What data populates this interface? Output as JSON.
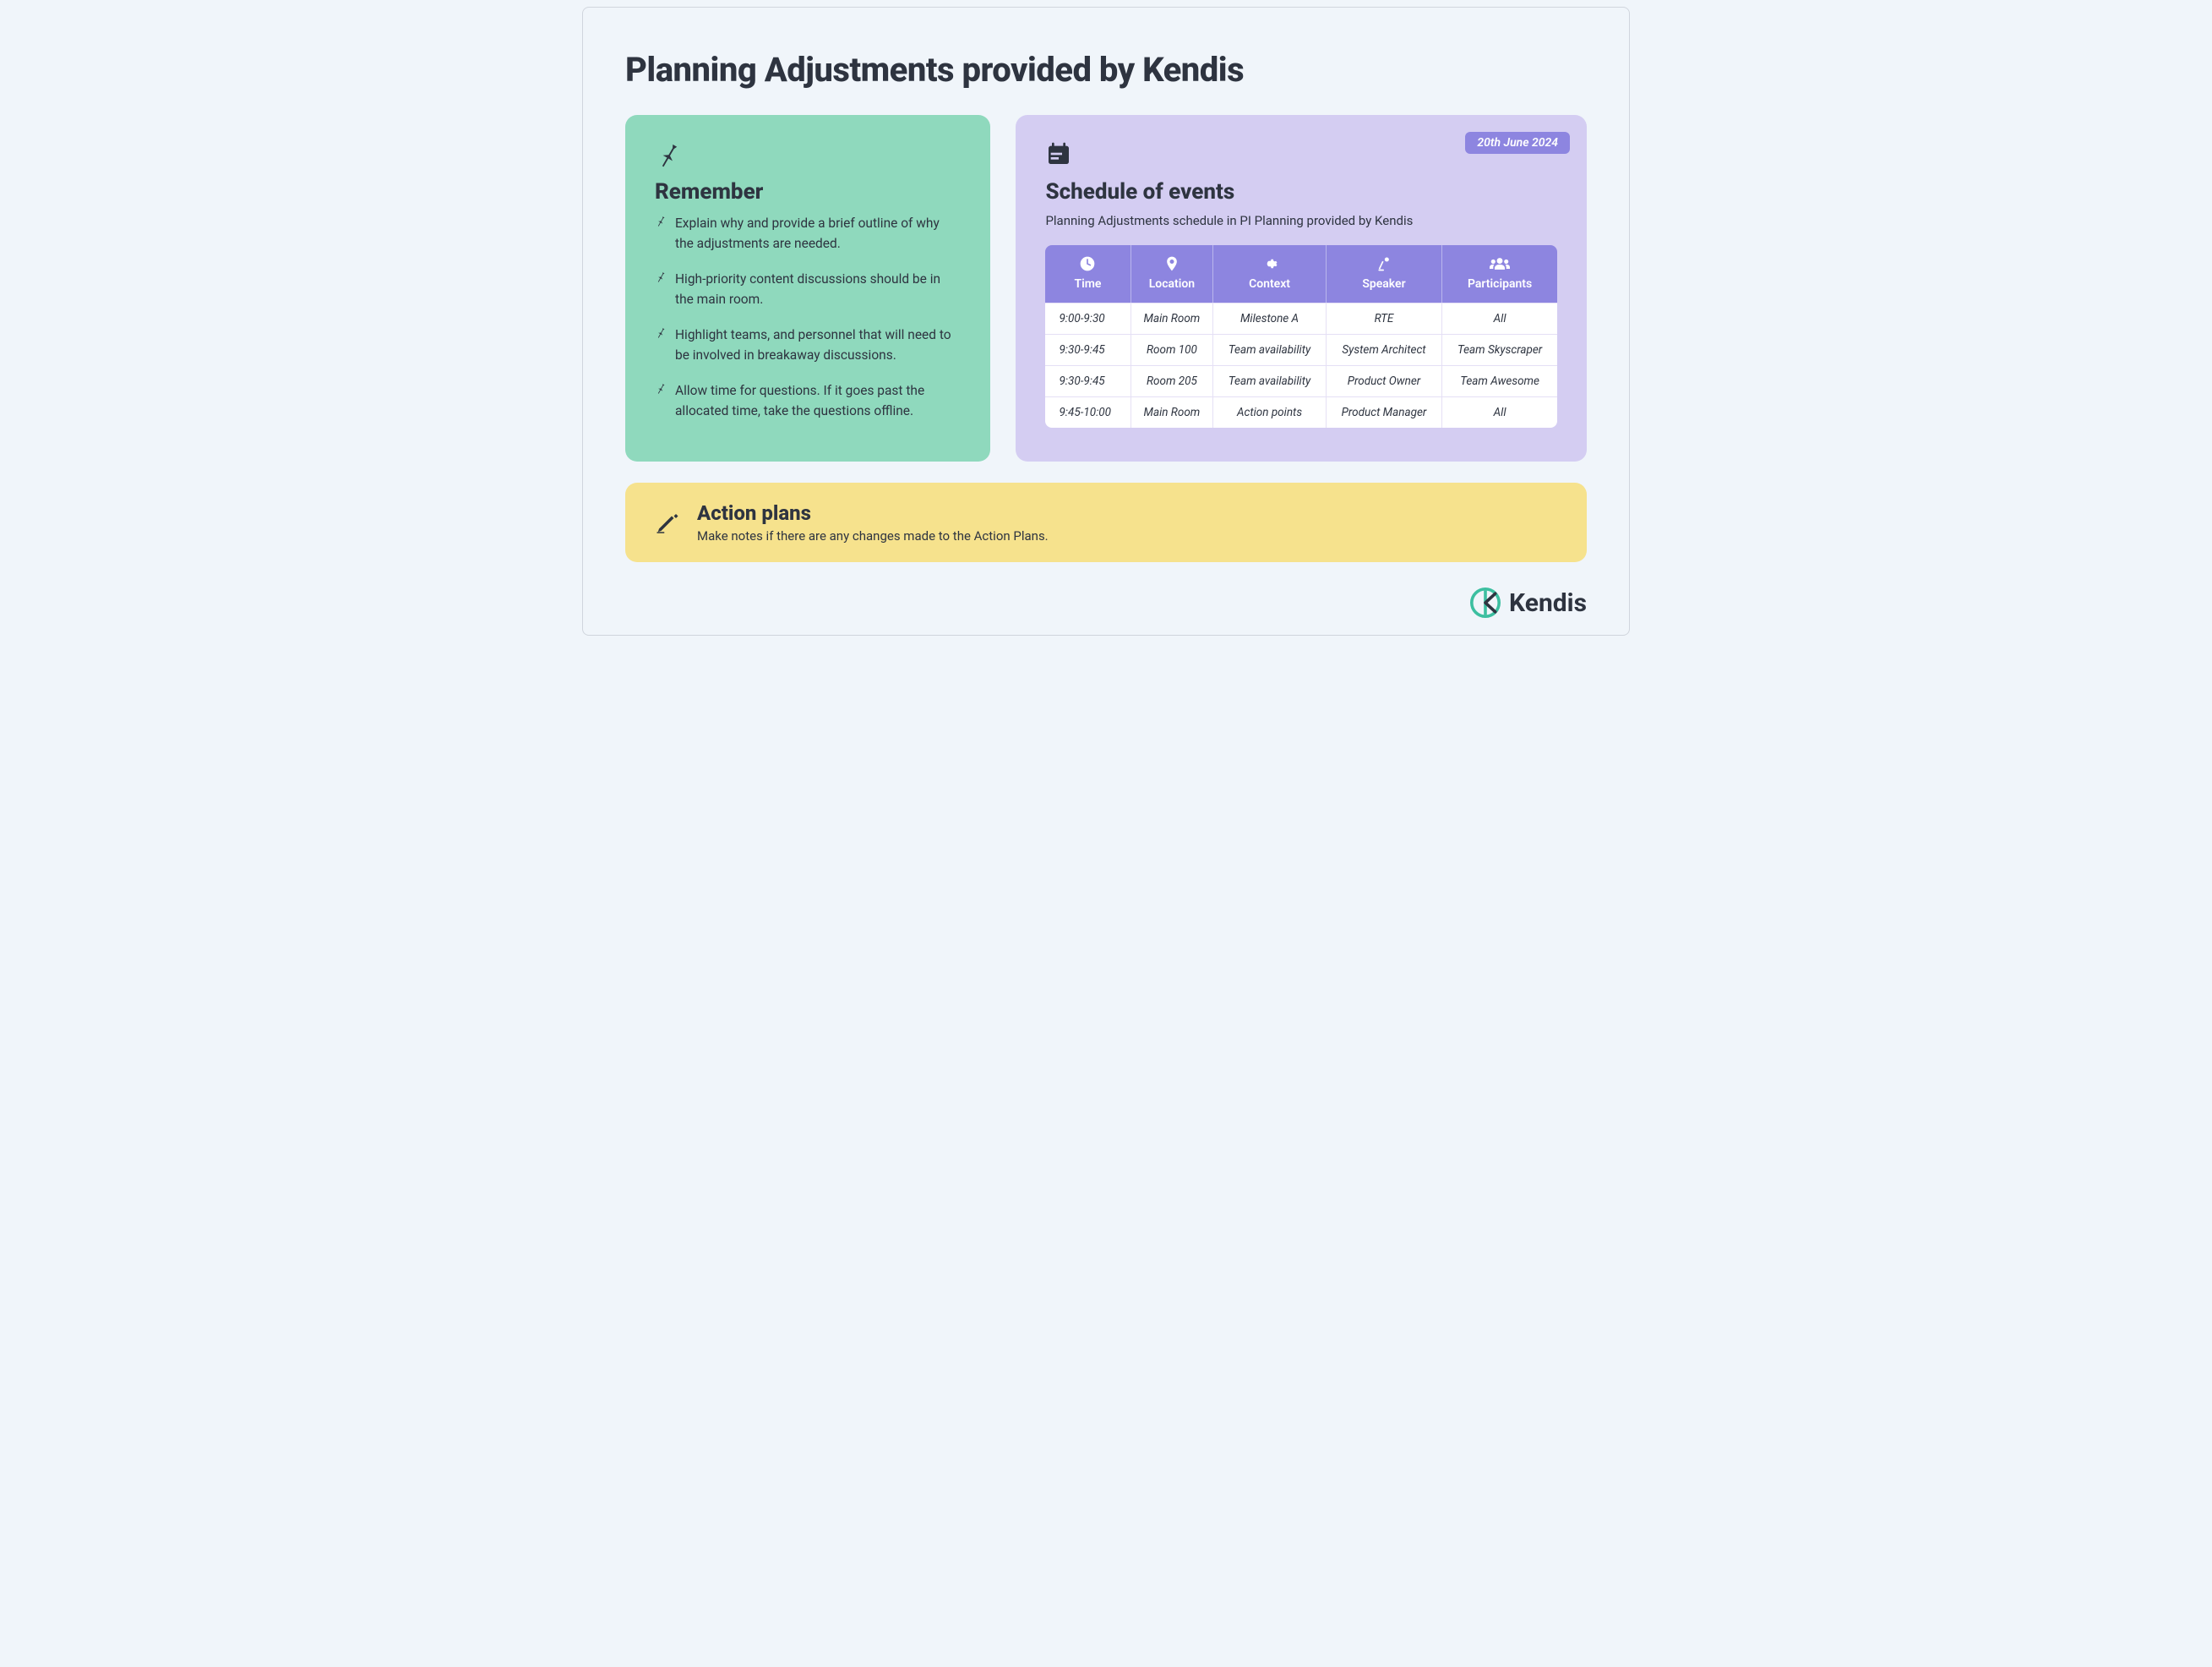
{
  "title": "Planning Adjustments provided by Kendis",
  "remember": {
    "heading": "Remember",
    "items": [
      "Explain why and provide a brief outline of why the adjustments are needed.",
      "High-priority content discussions should be in the main room.",
      "Highlight teams, and personnel that will need to be involved in breakaway discussions.",
      "Allow time for questions. If it goes past the allocated time, take the questions offline."
    ]
  },
  "schedule": {
    "date": "20th June 2024",
    "heading": "Schedule of events",
    "sub": "Planning Adjustments schedule in PI Planning provided by Kendis",
    "columns": [
      "Time",
      "Location",
      "Context",
      "Speaker",
      "Participants"
    ],
    "rows": [
      {
        "time": "9:00-9:30",
        "location": "Main Room",
        "context": "Milestone A",
        "speaker": "RTE",
        "participants": "All"
      },
      {
        "time": "9:30-9:45",
        "location": "Room 100",
        "context": "Team availability",
        "speaker": "System Architect",
        "participants": "Team Skyscraper"
      },
      {
        "time": "9:30-9:45",
        "location": "Room 205",
        "context": "Team availability",
        "speaker": "Product Owner",
        "participants": "Team Awesome"
      },
      {
        "time": "9:45-10:00",
        "location": "Main Room",
        "context": "Action points",
        "speaker": "Product Manager",
        "participants": "All"
      }
    ]
  },
  "action": {
    "heading": "Action plans",
    "sub": "Make notes if there are any changes made to the Action Plans."
  },
  "brand": "Kendis"
}
